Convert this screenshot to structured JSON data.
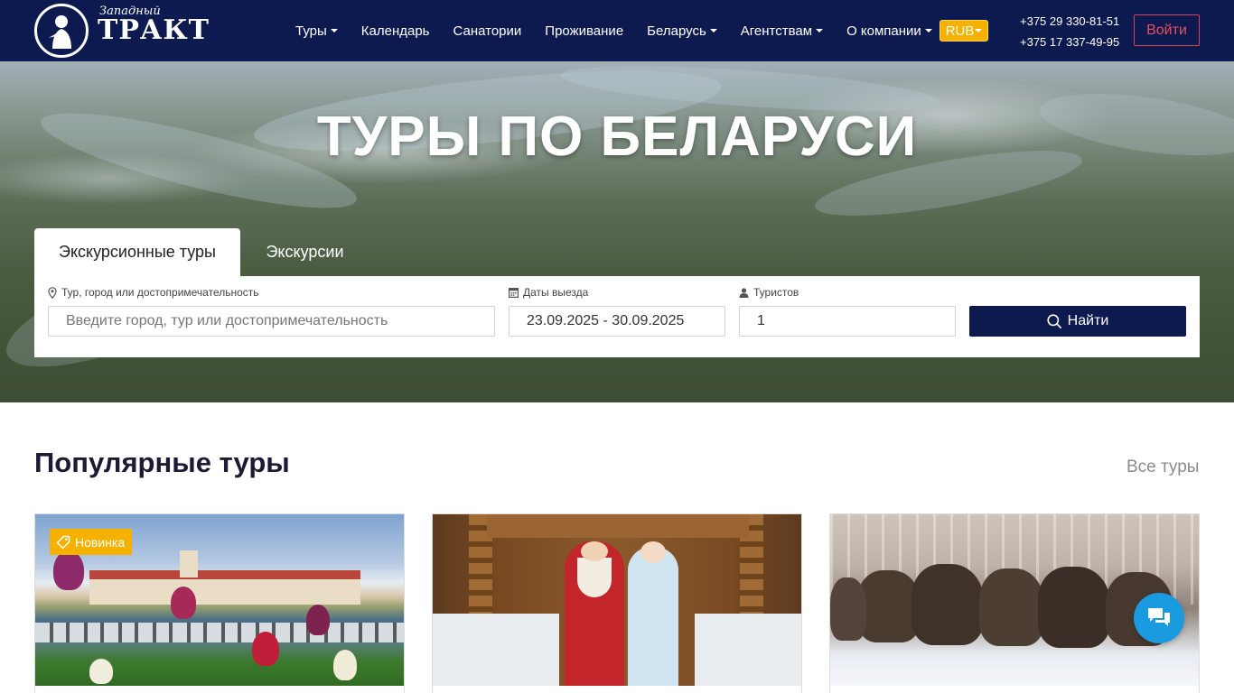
{
  "brand": {
    "logo_top": "Западный",
    "logo_main": "ТРАКТ"
  },
  "nav": {
    "items": [
      {
        "label": "Туры",
        "dropdown": true
      },
      {
        "label": "Календарь",
        "dropdown": false
      },
      {
        "label": "Санатории",
        "dropdown": false
      },
      {
        "label": "Проживание",
        "dropdown": false
      },
      {
        "label": "Беларусь",
        "dropdown": true
      },
      {
        "label": "Агентствам",
        "dropdown": true
      },
      {
        "label": "О компании",
        "dropdown": true
      }
    ],
    "currency": "RUB",
    "phones": [
      "+375 29 330-81-51",
      "+375 17 337-49-95"
    ],
    "login_label": "Войти"
  },
  "hero": {
    "title": "ТУРЫ ПО БЕЛАРУСИ",
    "tabs": [
      {
        "label": "Экскурсионные туры",
        "active": true
      },
      {
        "label": "Экскурсии",
        "active": false
      }
    ]
  },
  "search": {
    "destination_label": "Тур, город или достопримечательность",
    "destination_placeholder": "Введите город, тур или достопримечательность",
    "dates_label": "Даты выезда",
    "dates_value": "23.09.2025 - 30.09.2025",
    "tourists_label": "Туристов",
    "tourists_value": "1",
    "button_label": "Найти"
  },
  "popular": {
    "title": "Популярные туры",
    "all_link": "Все туры",
    "cards": [
      {
        "badge": "Новинка"
      },
      {
        "badge": ""
      },
      {
        "badge": ""
      }
    ]
  },
  "colors": {
    "navy": "#0d1a4f",
    "accent_yellow": "#f5b100",
    "login_red": "#e8505c",
    "chat_blue": "#1a9be0"
  },
  "icons": [
    "location-pin-icon",
    "calendar-icon",
    "person-icon",
    "search-icon",
    "tag-icon",
    "chat-icon"
  ]
}
